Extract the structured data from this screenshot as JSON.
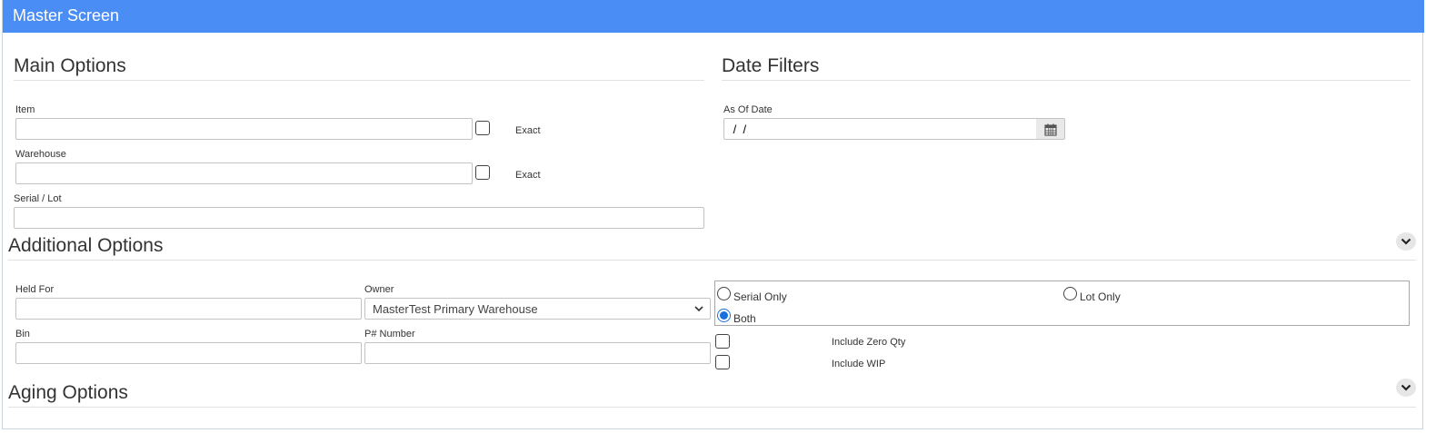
{
  "window": {
    "title": "Master Screen"
  },
  "main_options": {
    "title": "Main Options",
    "item": {
      "label": "Item",
      "value": "",
      "exact_label": "Exact",
      "exact_checked": false
    },
    "warehouse": {
      "label": "Warehouse",
      "value": "",
      "exact_label": "Exact",
      "exact_checked": false
    },
    "serial_lot": {
      "label": "Serial / Lot",
      "value": ""
    }
  },
  "date_filters": {
    "title": "Date Filters",
    "as_of_date": {
      "label": "As Of Date",
      "value": " /  /",
      "icon": "calendar-icon"
    }
  },
  "additional_options": {
    "title": "Additional Options",
    "held_for": {
      "label": "Held For",
      "value": ""
    },
    "owner": {
      "label": "Owner",
      "selected": "MasterTest Primary Warehouse"
    },
    "bin": {
      "label": "Bin",
      "value": ""
    },
    "p_number": {
      "label": "P# Number",
      "value": ""
    },
    "radios": [
      {
        "label": "Serial Only",
        "checked": false
      },
      {
        "label": "Lot Only",
        "checked": false
      },
      {
        "label": "Both",
        "checked": true
      }
    ],
    "include_zero_qty": {
      "label": "Include Zero Qty",
      "checked": false
    },
    "include_wip": {
      "label": "Include WIP",
      "checked": false
    },
    "expand_icon": "chevron-down-icon"
  },
  "aging_options": {
    "title": "Aging Options",
    "expand_icon": "chevron-down-icon"
  },
  "colors": {
    "header": "#4a8ef5",
    "radio_accent": "#1a6fe0"
  }
}
